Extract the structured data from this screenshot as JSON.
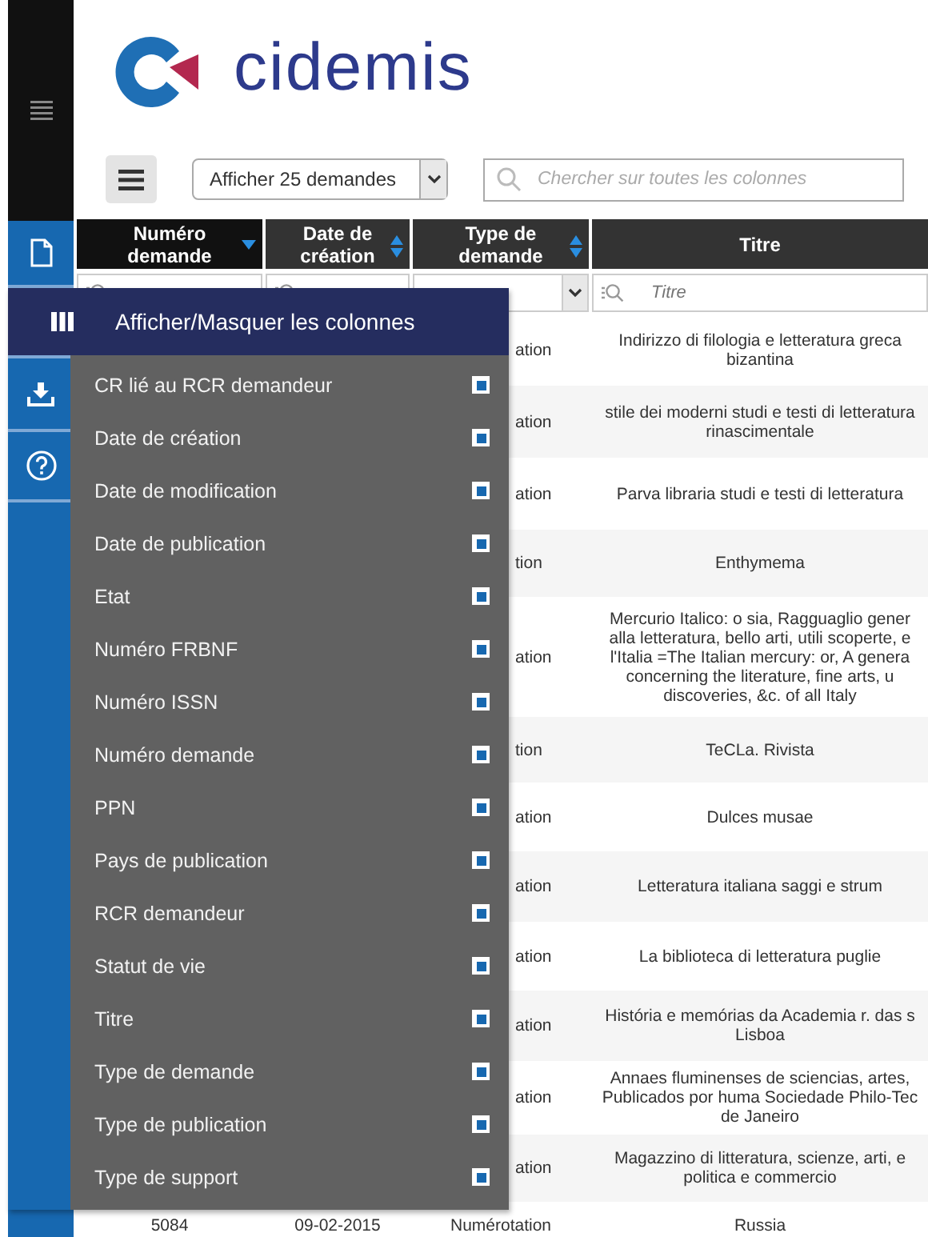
{
  "logo": {
    "text": "cidemis"
  },
  "toolbar": {
    "page_size": {
      "value": "Afficher 25 demandes"
    },
    "search": {
      "placeholder": "Chercher sur toutes les colonnes"
    }
  },
  "table": {
    "columns": [
      {
        "label": "Numéro demande",
        "sortable": true,
        "sorted": true
      },
      {
        "label": "Date de création",
        "sortable": true,
        "sorted": false
      },
      {
        "label": "Type de demande",
        "sortable": true,
        "sorted": false
      },
      {
        "label": "Titre",
        "sortable": false
      }
    ],
    "filters": [
      {
        "kind": "text"
      },
      {
        "kind": "text"
      },
      {
        "kind": "select"
      },
      {
        "kind": "text",
        "placeholder": "Titre"
      }
    ],
    "rows": [
      {
        "type": "ation",
        "title": [
          "Indirizzo di filologia e letteratura greca",
          "bizantina"
        ]
      },
      {
        "type": "ation",
        "title": [
          "stile dei moderni studi e testi di letteratura",
          "rinascimentale"
        ]
      },
      {
        "type": "ation",
        "title": [
          "Parva libraria studi e testi di letteratura"
        ]
      },
      {
        "type": "tion",
        "title": [
          "Enthymema"
        ]
      },
      {
        "type": "ation",
        "title": [
          "Mercurio Italico: o sia, Ragguaglio gener",
          "alla letteratura, bello arti, utili scoperte, e",
          "l'Italia =The Italian mercury: or, A genera",
          "concerning the literature, fine arts, u",
          "discoveries, &c. of all Italy"
        ]
      },
      {
        "type": "tion",
        "title": [
          "TeCLa. Rivista"
        ]
      },
      {
        "type": "ation",
        "title": [
          "Dulces musae"
        ]
      },
      {
        "type": "ation",
        "title": [
          "Letteratura italiana saggi e strum"
        ]
      },
      {
        "type": "ation",
        "title": [
          "La biblioteca di letteratura puglie"
        ]
      },
      {
        "type": "ation",
        "title": [
          "História e memórias da Academia r. das s",
          "Lisboa"
        ]
      },
      {
        "type": "ation",
        "title": [
          "Annaes fluminenses de sciencias, artes,",
          "Publicados por huma Sociedade Philo-Tec",
          "de Janeiro"
        ]
      },
      {
        "type": "ation",
        "title": [
          "Magazzino di litteratura, scienze, arti, e",
          "politica e commercio"
        ]
      },
      {
        "numero": "5084",
        "date": "09-02-2015",
        "type": "Numérotation",
        "title": [
          "Russia"
        ]
      }
    ]
  },
  "column_menu": {
    "title": "Afficher/Masquer les colonnes",
    "items": [
      {
        "label": "CR lié au RCR demandeur",
        "checked": true
      },
      {
        "label": "Date de création",
        "checked": true
      },
      {
        "label": "Date de modification",
        "checked": true
      },
      {
        "label": "Date de publication",
        "checked": true
      },
      {
        "label": "Etat",
        "checked": true
      },
      {
        "label": "Numéro FRBNF",
        "checked": true
      },
      {
        "label": "Numéro ISSN",
        "checked": true
      },
      {
        "label": "Numéro demande",
        "checked": true
      },
      {
        "label": "PPN",
        "checked": true
      },
      {
        "label": "Pays de publication",
        "checked": true
      },
      {
        "label": "RCR demandeur",
        "checked": true
      },
      {
        "label": "Statut de vie",
        "checked": true
      },
      {
        "label": "Titre",
        "checked": true
      },
      {
        "label": "Type de demande",
        "checked": true
      },
      {
        "label": "Type de publication",
        "checked": true
      },
      {
        "label": "Type de support",
        "checked": true
      }
    ]
  }
}
